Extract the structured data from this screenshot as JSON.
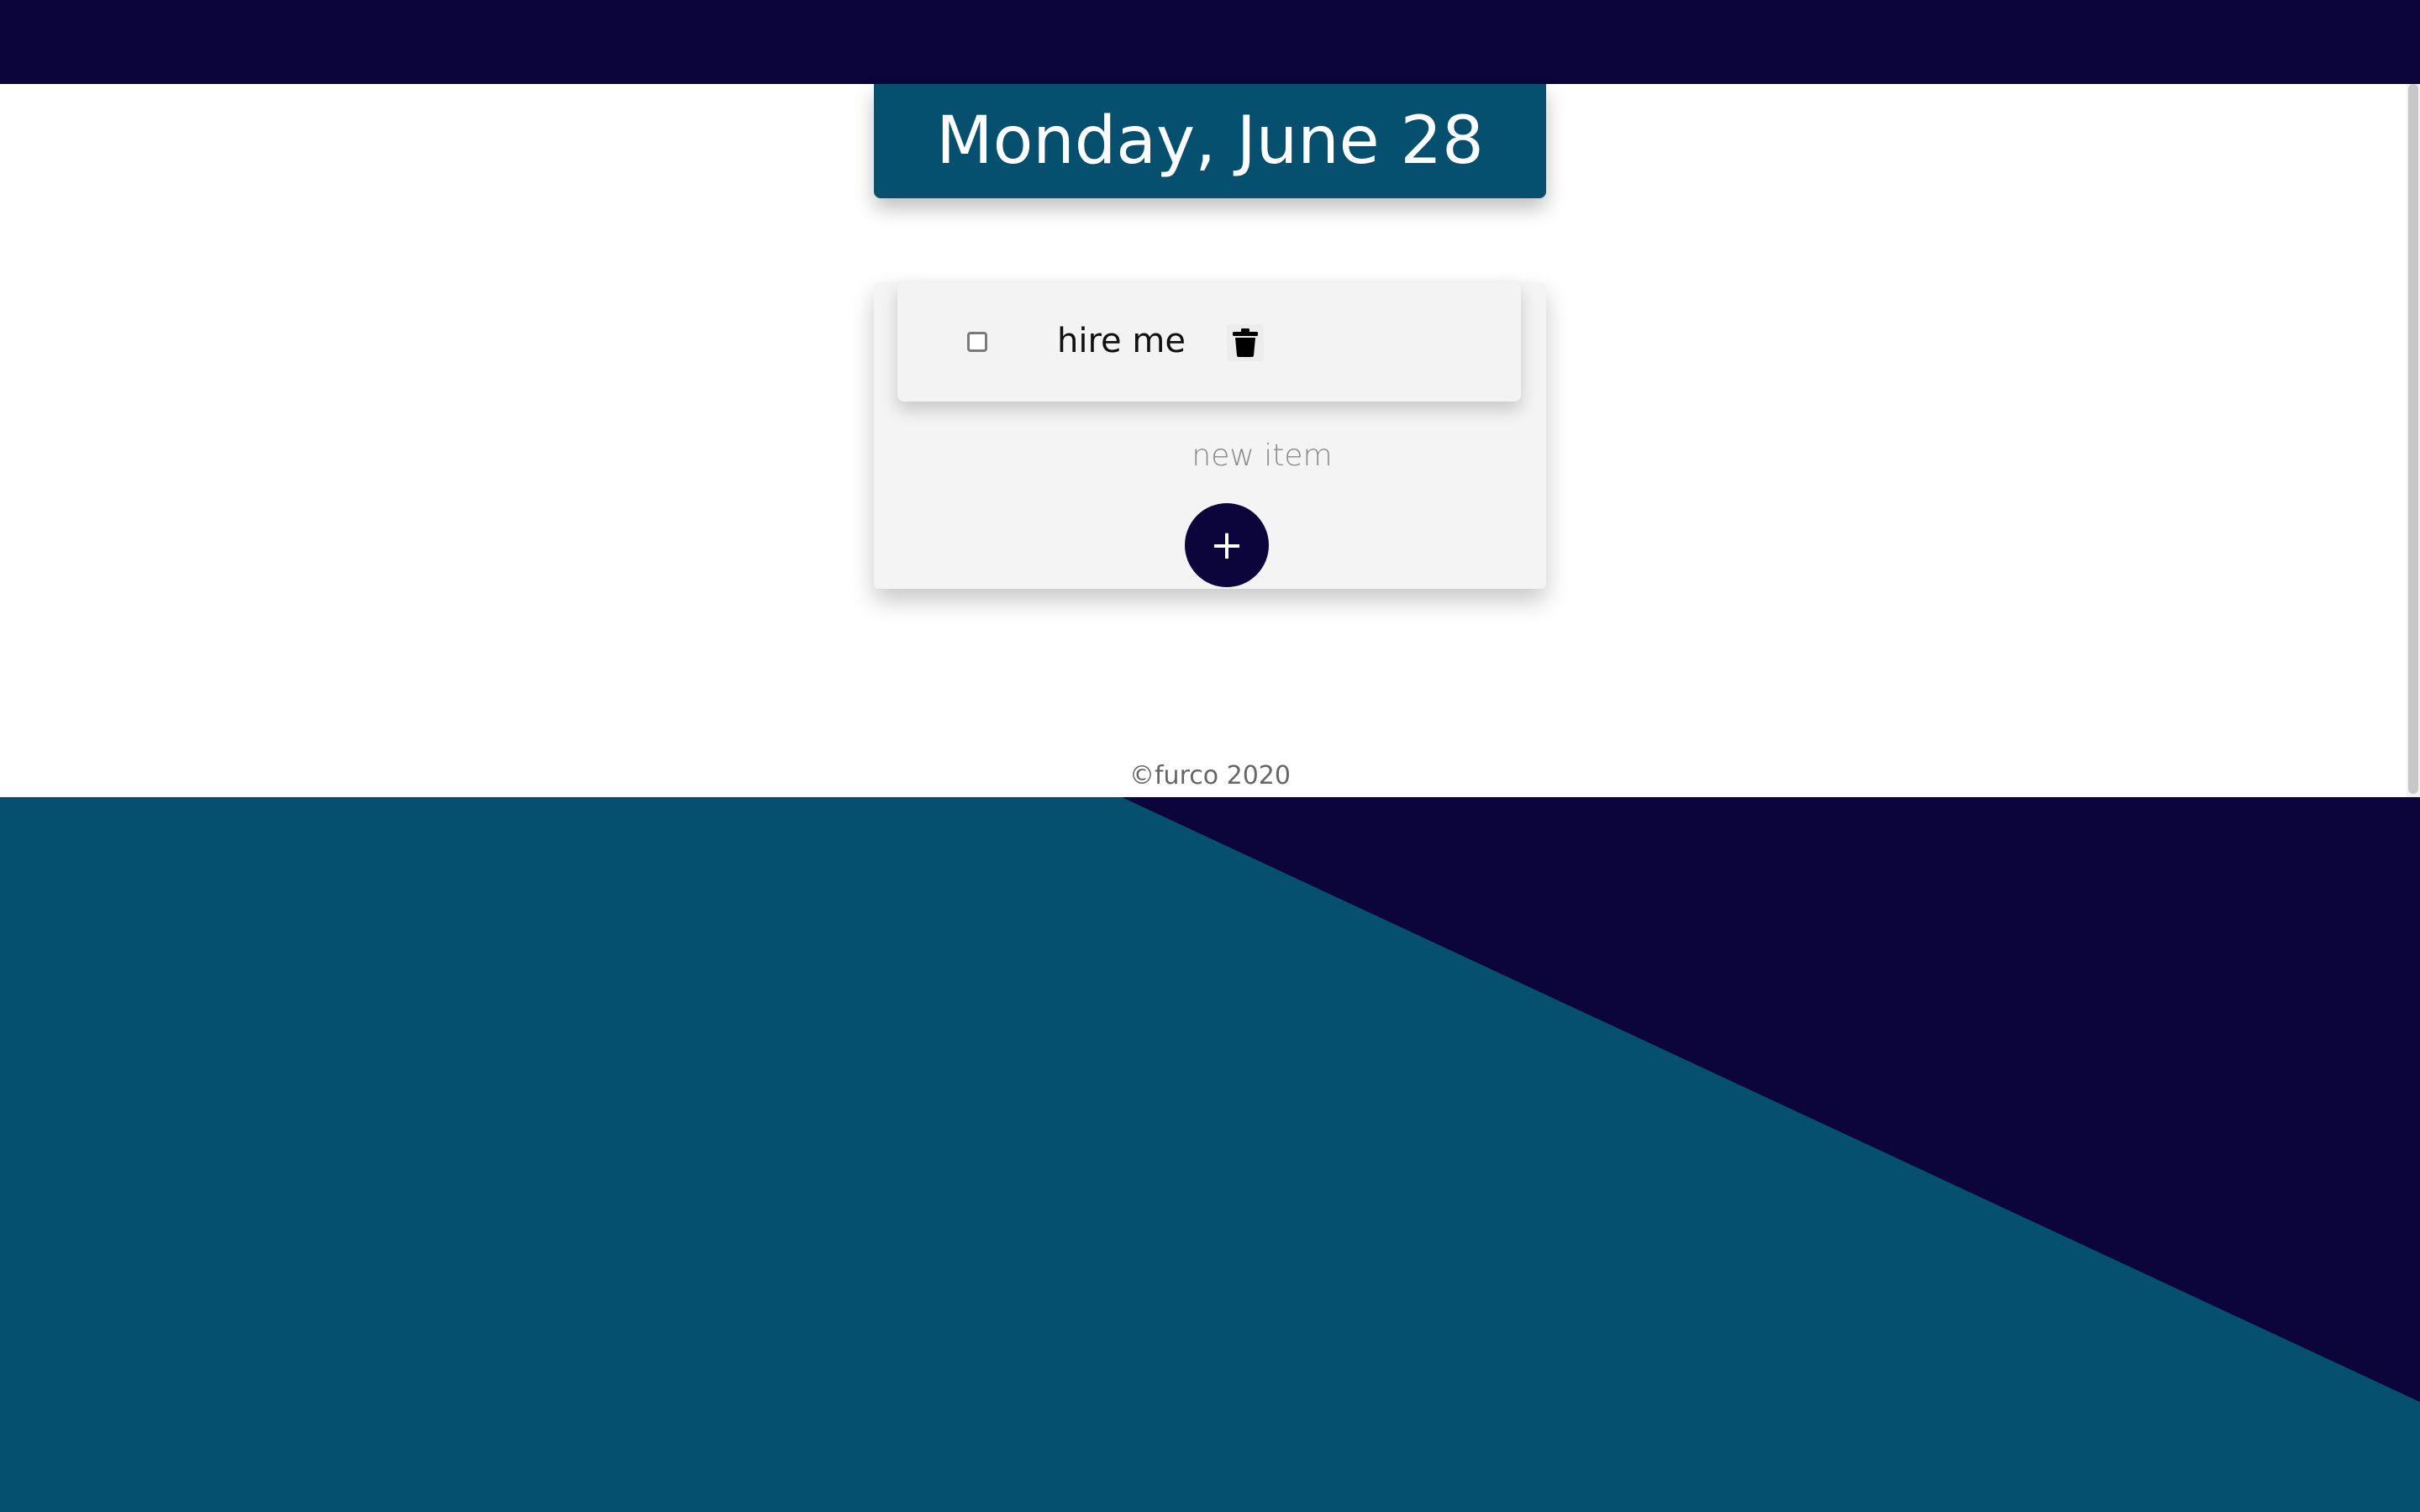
{
  "header": {
    "date": "Monday, June 28"
  },
  "todo": {
    "items": [
      {
        "text": "hire me",
        "checked": false
      }
    ],
    "new_item_placeholder": "new item",
    "add_button_label": "+"
  },
  "footer": {
    "text": "©furco 2020"
  },
  "colors": {
    "navy": "#0b053b",
    "teal": "#05506e",
    "card_bg": "#f4f4f4"
  }
}
